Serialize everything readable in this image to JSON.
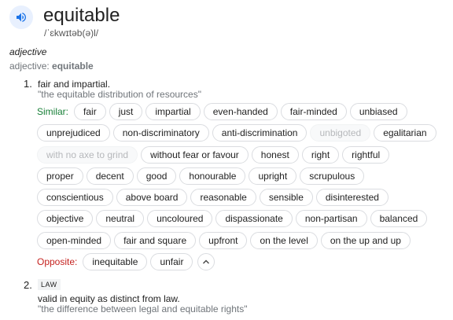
{
  "entry": {
    "word": "equitable",
    "phonetic": "/ˈɛkwɪtəb(ə)l/",
    "speaker_icon": "speaker-icon",
    "part_of_speech": "adjective",
    "forms_label": "adjective:",
    "forms_value": "equitable"
  },
  "sense1": {
    "number": "1.",
    "definition": "fair and impartial.",
    "example": "\"the equitable distribution of resources\"",
    "similar_label": "Similar:",
    "opposite_label": "Opposite:",
    "synonym_rows": [
      [
        "fair",
        "just",
        "impartial",
        "even-handed",
        "fair-minded",
        "unbiased"
      ],
      [
        "unprejudiced",
        "non-discriminatory",
        "anti-discrimination",
        "unbigoted",
        "egalitarian"
      ],
      [
        "with no axe to grind",
        "without fear or favour",
        "honest",
        "right",
        "rightful"
      ],
      [
        "proper",
        "decent",
        "good",
        "honourable",
        "upright",
        "scrupulous"
      ],
      [
        "conscientious",
        "above board",
        "reasonable",
        "sensible",
        "disinterested"
      ],
      [
        "objective",
        "neutral",
        "uncoloured",
        "dispassionate",
        "non-partisan",
        "balanced"
      ],
      [
        "open-minded",
        "fair and square",
        "upfront",
        "on the level",
        "on the up and up"
      ]
    ],
    "faded_synonyms": [
      "unbigoted",
      "with no axe to grind"
    ],
    "antonyms": [
      "inequitable",
      "unfair"
    ],
    "collapse_icon": "chevron-up-icon"
  },
  "sense2": {
    "number": "2.",
    "tag": "LAW",
    "definition": "valid in equity as distinct from law.",
    "example": "\"the difference between legal and equitable rights\""
  }
}
